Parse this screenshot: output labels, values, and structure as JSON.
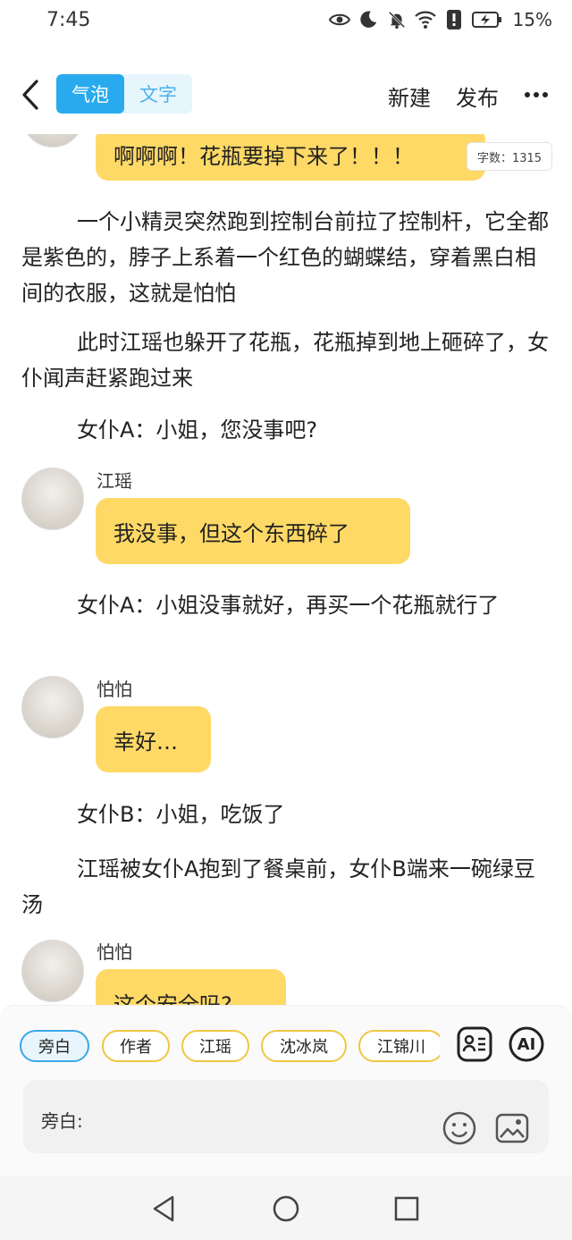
{
  "status_bar": {
    "time": "7:45",
    "battery_percent": "15%",
    "icons": [
      "eye-icon",
      "moon-icon",
      "bell-off-icon",
      "wifi-icon",
      "alert-icon",
      "battery-charging-icon"
    ]
  },
  "header": {
    "mode_tabs": [
      "气泡",
      "文字"
    ],
    "active_mode": "气泡",
    "new_label": "新建",
    "publish_label": "发布"
  },
  "word_count": "字数：1315",
  "messages": {
    "m0": {
      "text": "啊啊啊！花瓶要掉下来了！！！"
    },
    "n1": {
      "text": "一个小精灵突然跑到控制台前拉了控制杆，它全都是紫色的，脖子上系着一个红色的蝴蝶结，穿着黑白相间的衣服，这就是怕怕"
    },
    "n2": {
      "text": "此时江瑶也躲开了花瓶，花瓶掉到地上砸碎了，女仆闻声赶紧跑过来"
    },
    "n3": {
      "text": "女仆A：小姐，您没事吧?"
    },
    "m4": {
      "speaker": "江瑶",
      "text": "我没事，但这个东西碎了"
    },
    "n5": {
      "text": "女仆A：小姐没事就好，再买一个花瓶就行了"
    },
    "m6": {
      "speaker": "怕怕",
      "text": "幸好…"
    },
    "n7": {
      "text": "女仆B：小姐，吃饭了"
    },
    "n8": {
      "text": "江瑶被女仆A抱到了餐桌前，女仆B端来一碗绿豆汤"
    },
    "m9": {
      "speaker": "怕怕",
      "text": "这个安全吗?"
    }
  },
  "roles": [
    "旁白",
    "作者",
    "江瑶",
    "沈冰岚",
    "江锦川"
  ],
  "active_role": "旁白",
  "ai_label": "AI",
  "input": {
    "label": "旁白:"
  },
  "colors": {
    "accent_blue": "#29aaee",
    "bubble_yellow": "#ffd966",
    "chip_border": "#f0c640"
  }
}
